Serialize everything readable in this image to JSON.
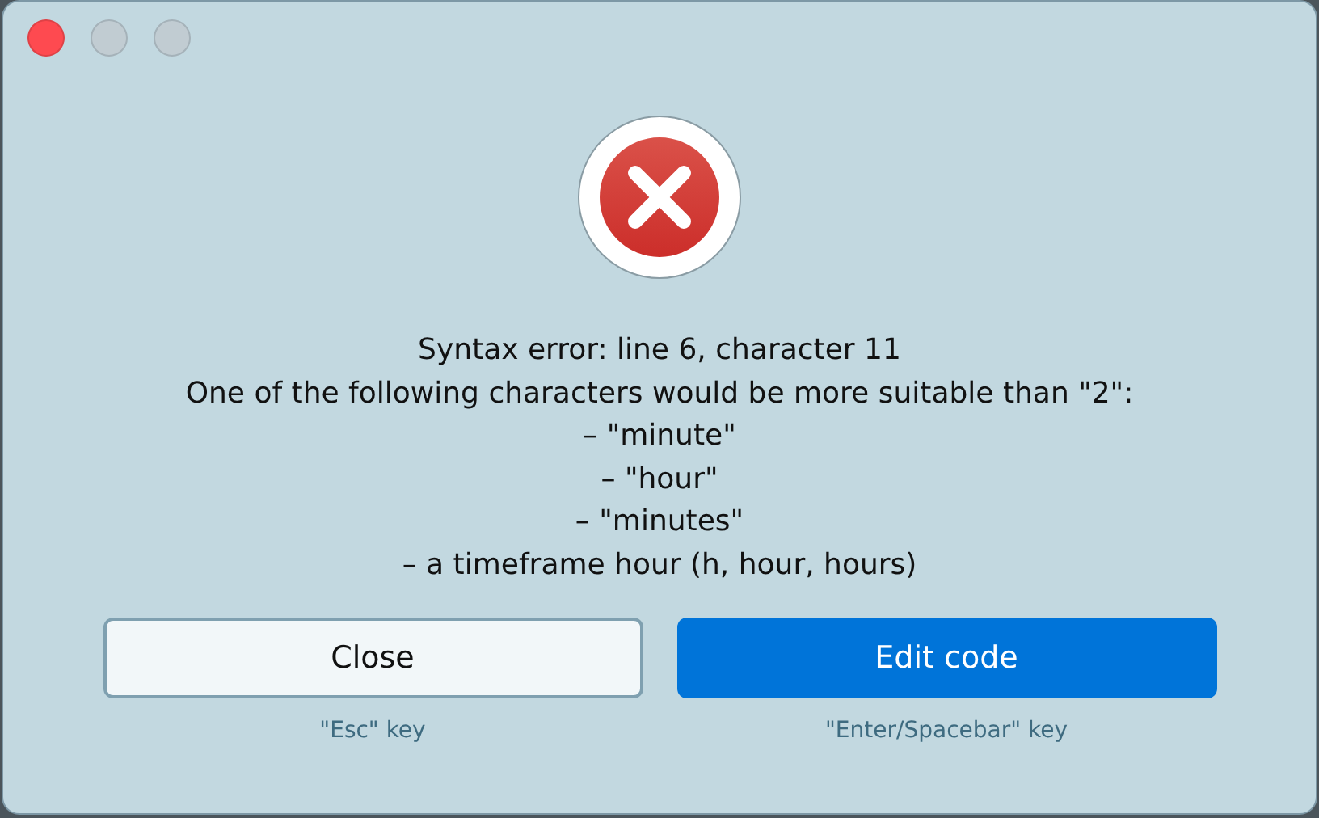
{
  "window_controls": [
    {
      "kind": "close",
      "enabled": true
    },
    {
      "kind": "minimize",
      "enabled": false
    },
    {
      "kind": "zoom",
      "enabled": false
    }
  ],
  "message": {
    "kind": "error",
    "lines": [
      "Syntax error: line 6, character 11",
      "One of the following characters would be more suitable than \"2\":",
      "– \"minute\"",
      "– \"hour\"",
      "– \"minutes\"",
      "– a timeframe hour (h, hour, hours)"
    ]
  },
  "buttons": [
    {
      "label": "Close",
      "kind": "secondary",
      "hint": "\"Esc\" key"
    },
    {
      "label": "Edit code",
      "kind": "primary",
      "hint": "\"Enter/Spacebar\" key"
    }
  ]
}
